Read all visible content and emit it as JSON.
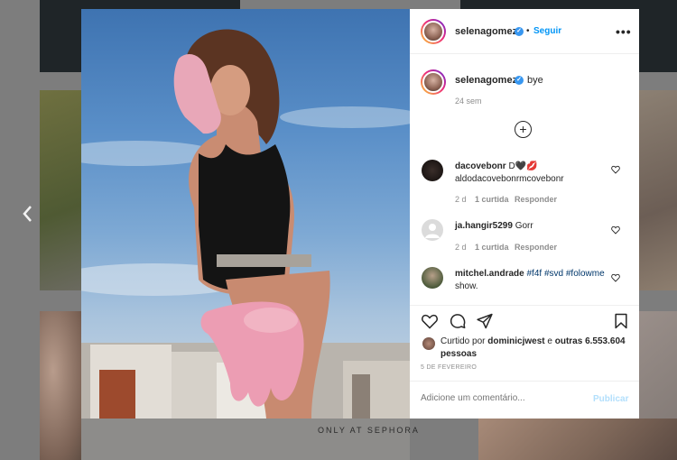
{
  "background": {
    "banner_text": "ONLY AT SEPHORA"
  },
  "nav": {
    "prev_icon": "chevron-left-icon",
    "prev_glyph": "‹"
  },
  "post": {
    "header": {
      "username": "selenagomez",
      "separator": "•",
      "follow_label": "Seguir",
      "more_glyph": "•••"
    },
    "caption": {
      "username": "selenagomez",
      "text": "bye",
      "time": "24 sem"
    },
    "load_more_glyph": "+",
    "comments": [
      {
        "username": "dacovebonr",
        "text": "D🖤💋 aldodacovebonrmcovebonr",
        "time": "2 d",
        "likes": "1 curtida",
        "reply": "Responder"
      },
      {
        "username": "ja.hangir5299",
        "text": "Gorr",
        "time": "2 d",
        "likes": "1 curtida",
        "reply": "Responder"
      },
      {
        "username": "mitchel.andrade",
        "tags": "#f4f #svd",
        "tag2": "#folowme",
        "text_after": "show."
      }
    ],
    "liked_by": {
      "prefix": "Curtido por",
      "user": "dominicjwest",
      "mid": "e",
      "others": "outras 6.553.604 pessoas"
    },
    "date": "5 DE FEVEREIRO",
    "add_comment": {
      "placeholder": "Adicione um comentário...",
      "publish_label": "Publicar"
    }
  },
  "colors": {
    "accent": "#0095f6",
    "verified": "#3897f0",
    "publish_disabled": "#b2dffc"
  }
}
